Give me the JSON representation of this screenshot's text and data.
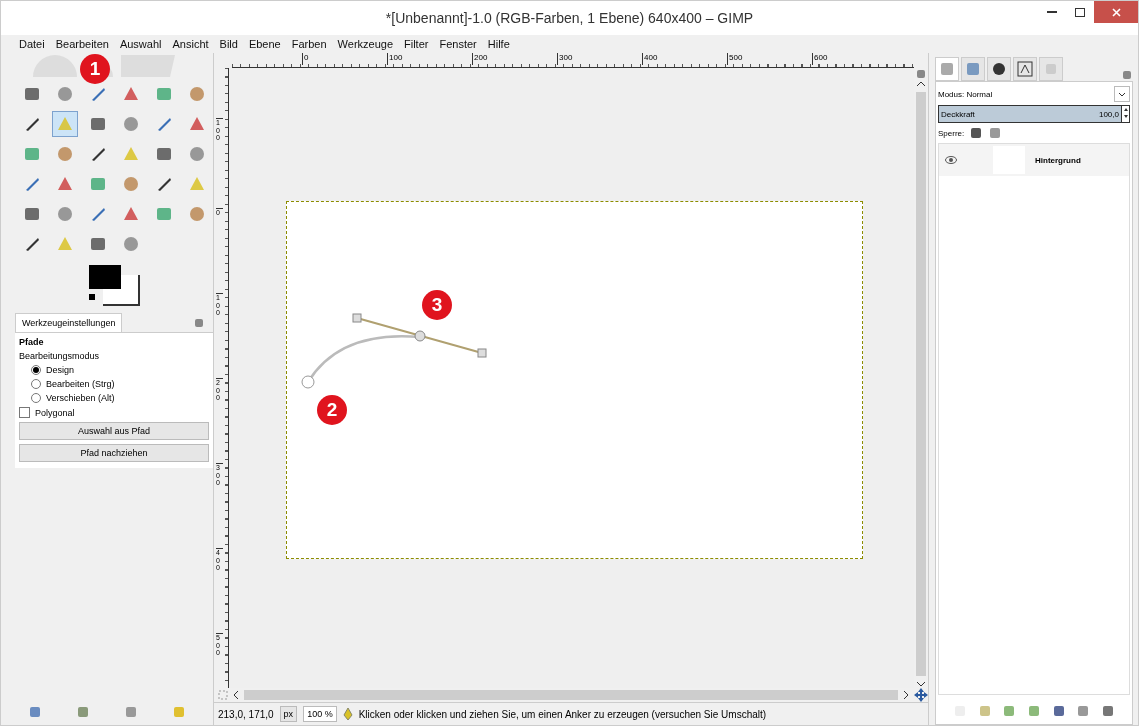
{
  "window": {
    "title": "*[Unbenannt]-1.0 (RGB-Farben, 1 Ebene) 640x400 – GIMP"
  },
  "menu": [
    {
      "label": "Datei"
    },
    {
      "label": "Bearbeiten"
    },
    {
      "label": "Auswahl"
    },
    {
      "label": "Ansicht"
    },
    {
      "label": "Bild"
    },
    {
      "label": "Ebene"
    },
    {
      "label": "Farben"
    },
    {
      "label": "Werkzeuge"
    },
    {
      "label": "Filter"
    },
    {
      "label": "Fenster"
    },
    {
      "label": "Hilfe"
    }
  ],
  "toolbox": {
    "tools": [
      {
        "selected": false
      },
      {
        "selected": false
      },
      {
        "selected": false
      },
      {
        "selected": false
      },
      {
        "selected": false
      },
      {
        "selected": false
      },
      {
        "selected": false
      },
      {
        "selected": true
      },
      {
        "selected": false
      },
      {
        "selected": false
      },
      {
        "selected": false
      },
      {
        "selected": false
      },
      {
        "selected": false
      },
      {
        "selected": false
      },
      {
        "selected": false
      },
      {
        "selected": false
      },
      {
        "selected": false
      },
      {
        "selected": false
      },
      {
        "selected": false
      },
      {
        "selected": false
      },
      {
        "selected": false
      },
      {
        "selected": false
      },
      {
        "selected": false
      },
      {
        "selected": false
      },
      {
        "selected": false
      },
      {
        "selected": false
      },
      {
        "selected": false
      },
      {
        "selected": false
      },
      {
        "selected": false
      },
      {
        "selected": false
      },
      {
        "selected": false
      },
      {
        "selected": false
      },
      {
        "selected": false
      },
      {
        "selected": false
      }
    ]
  },
  "tool_options": {
    "tab": "Werkzeugeinstellungen",
    "title": "Pfade",
    "section": "Bearbeitungsmodus",
    "modes": [
      {
        "label": "Design",
        "selected": true
      },
      {
        "label": "Bearbeiten (Strg)",
        "selected": false
      },
      {
        "label": "Verschieben (Alt)",
        "selected": false
      }
    ],
    "polygonal": {
      "label": "Polygonal",
      "checked": false
    },
    "buttons": [
      "Auswahl aus Pfad",
      "Pfad nachziehen"
    ]
  },
  "ruler": {
    "horizontal": [
      "0",
      "100",
      "200",
      "300",
      "400",
      "500",
      "600"
    ],
    "vertical": [
      "100",
      "0",
      "100",
      "200",
      "300",
      "400",
      "500"
    ]
  },
  "markers": [
    "1",
    "2",
    "3"
  ],
  "status_bar": {
    "coordinates": "213,0, 171,0",
    "unit": "px",
    "zoom": "100 %",
    "message": "Klicken oder klicken und ziehen Sie, um einen Anker zu erzeugen (versuchen Sie Umschalt)"
  },
  "layers_dock": {
    "mode": "Modus: Normal",
    "opacity": {
      "label": "Deckkraft",
      "reading": "100,0",
      "level": 1
    },
    "lock": "Sperre:",
    "layers": [
      {
        "name": "Hintergrund",
        "visible": true
      }
    ]
  }
}
